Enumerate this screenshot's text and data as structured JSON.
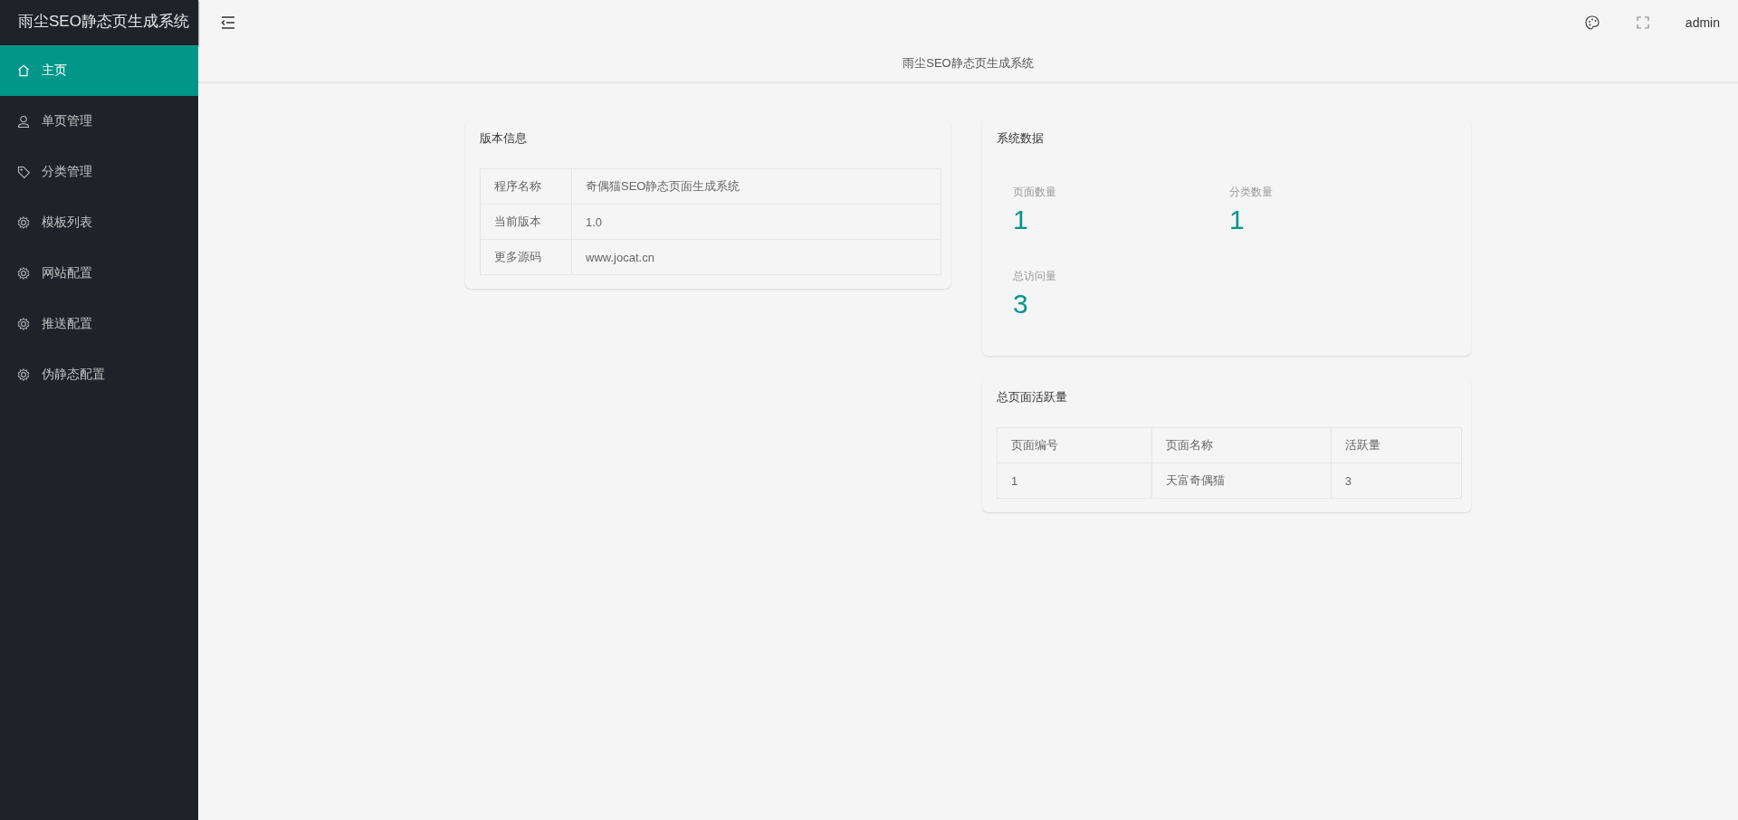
{
  "sidebar": {
    "logo": "雨尘SEO静态页生成系统",
    "items": [
      {
        "label": "主页",
        "kind": "home",
        "selected": true
      },
      {
        "label": "单页管理",
        "kind": "user",
        "selected": false
      },
      {
        "label": "分类管理",
        "kind": "tag",
        "selected": false
      },
      {
        "label": "模板列表",
        "kind": "gear",
        "selected": false
      },
      {
        "label": "网站配置",
        "kind": "gear",
        "selected": false
      },
      {
        "label": "推送配置",
        "kind": "gear",
        "selected": false
      },
      {
        "label": "伪静态配置",
        "kind": "gear",
        "selected": false
      }
    ]
  },
  "header": {
    "user": "admin",
    "page_title": "雨尘SEO静态页生成系统"
  },
  "version_card": {
    "title": "版本信息",
    "rows": [
      {
        "label": "程序名称",
        "value": "奇偶猫SEO静态页面生成系统"
      },
      {
        "label": "当前版本",
        "value": "1.0"
      },
      {
        "label": "更多源码",
        "value": "www.jocat.cn"
      }
    ]
  },
  "stats_card": {
    "title": "系统数据",
    "stats": [
      {
        "label": "页面数量",
        "value": "1"
      },
      {
        "label": "分类数量",
        "value": "1"
      },
      {
        "label": "总访问量",
        "value": "3"
      }
    ]
  },
  "activity_card": {
    "title": "总页面活跃量",
    "columns": [
      "页面编号",
      "页面名称",
      "活跃量"
    ],
    "rows": [
      [
        "1",
        "天富奇偶猫",
        "3"
      ]
    ]
  }
}
